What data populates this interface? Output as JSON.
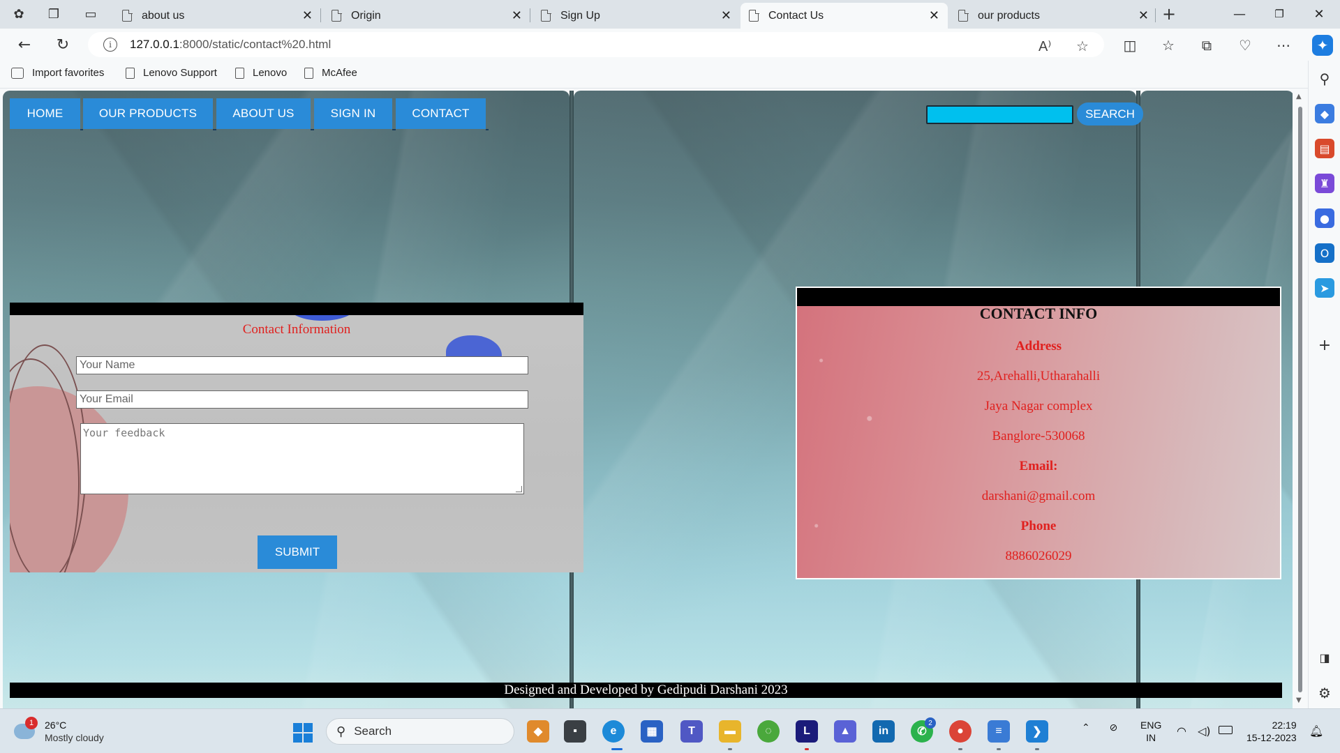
{
  "browser": {
    "tabs": [
      {
        "title": "about us"
      },
      {
        "title": "Origin"
      },
      {
        "title": "Sign Up"
      },
      {
        "title": "Contact Us",
        "active": true
      },
      {
        "title": "our products"
      }
    ],
    "url_host": "127.0.0.1",
    "url_path": ":8000/static/contact%20.html",
    "favorites": [
      "Import favorites",
      "Lenovo Support",
      "Lenovo",
      "McAfee"
    ]
  },
  "page": {
    "nav": [
      "HOME",
      "OUR PRODUCTS",
      "ABOUT US",
      "SIGN IN",
      "CONTACT"
    ],
    "search_button": "SEARCH",
    "search_value": "",
    "form": {
      "title": "Contact Information",
      "name_placeholder": "Your Name",
      "email_placeholder": "Your Email",
      "feedback_placeholder": "Your feedback",
      "submit_label": "SUBMIT"
    },
    "contact_info": {
      "title": "CONTACT INFO",
      "address_label": "Address",
      "address_line1": "25,Arehalli,Utharahalli",
      "address_line2": "Jaya Nagar complex",
      "address_line3": "Banglore-530068",
      "email_label": "Email:",
      "email": "darshani@gmail.com",
      "phone_label": "Phone",
      "phone": "8886026029"
    },
    "footer": "Designed and Developed by Gedipudi Darshani 2023"
  },
  "taskbar": {
    "weather_temp": "26°C",
    "weather_condition": "Mostly cloudy",
    "weather_badge": "1",
    "search_label": "Search",
    "whatsapp_badge": "2",
    "lang_line1": "ENG",
    "lang_line2": "IN",
    "time": "22:19",
    "date": "15-12-2023"
  },
  "colors": {
    "nav_button": "#2a8bd8",
    "search_input": "#00c0ee",
    "form_title_text": "#e0201e",
    "info_text": "#e0201e"
  }
}
